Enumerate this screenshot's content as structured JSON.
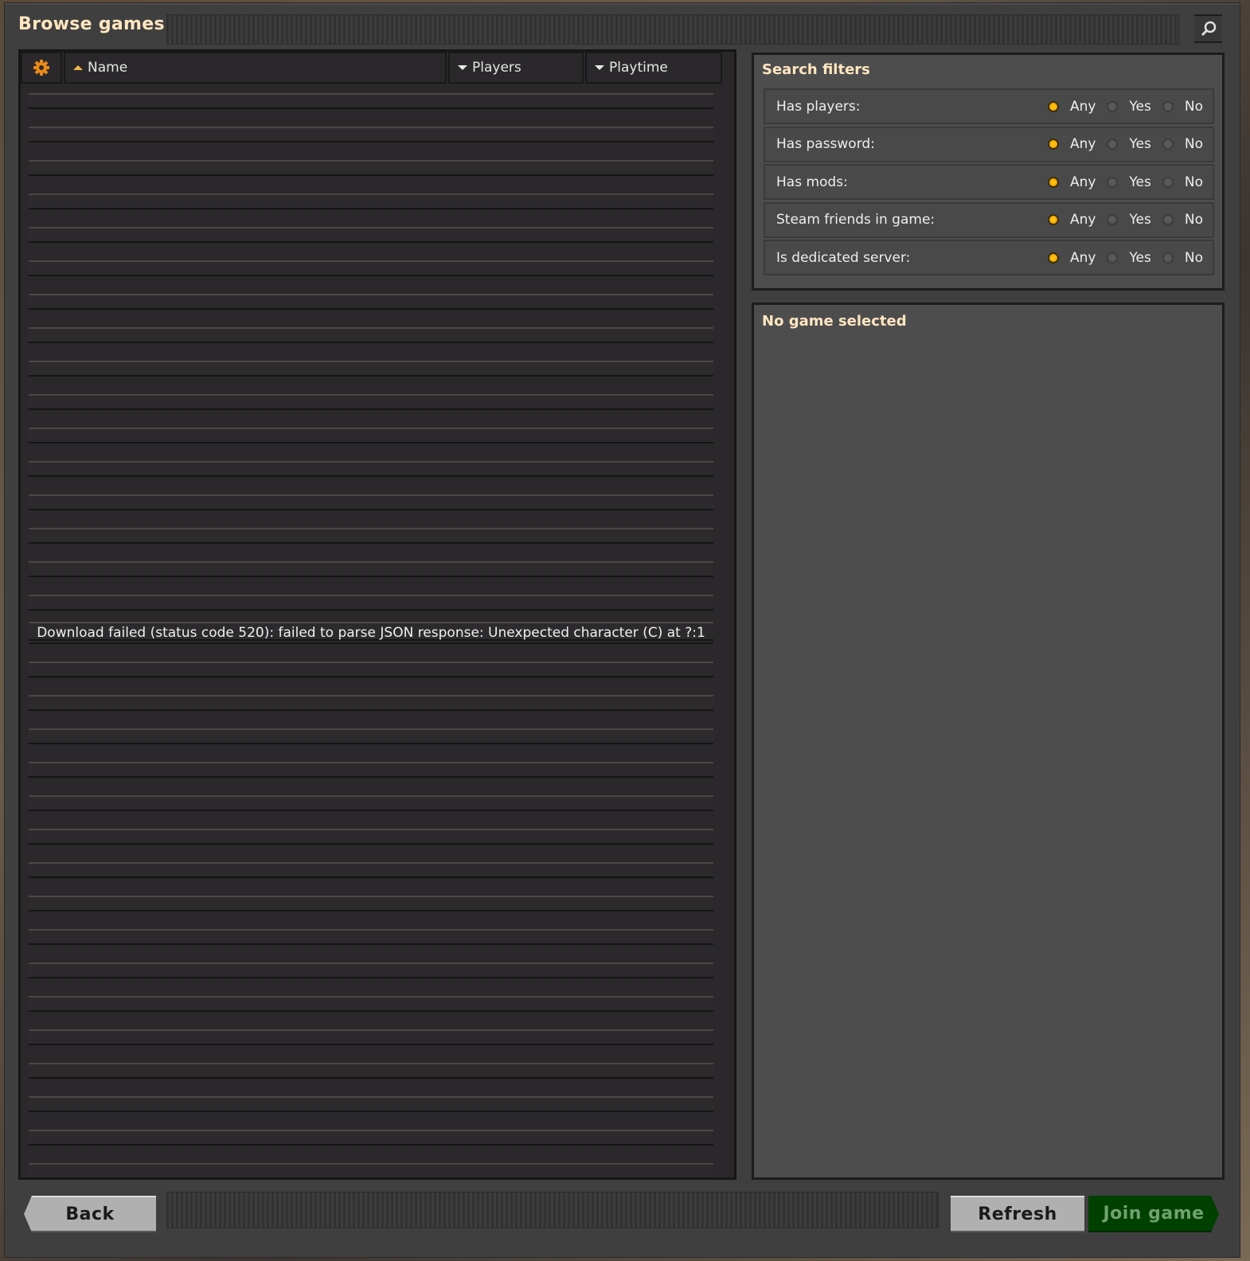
{
  "window": {
    "title": "Browse games"
  },
  "toolbar": {
    "search_icon": "magnifier-icon"
  },
  "list": {
    "settings_icon": "gear-icon",
    "columns": [
      {
        "label": "Name",
        "sort": "ascending"
      },
      {
        "label": "Players",
        "sort": "descending"
      },
      {
        "label": "Playtime",
        "sort": "descending"
      }
    ],
    "error_message": "Download failed (status code 520): failed to parse JSON response: Unexpected character (C) at ?:1"
  },
  "filters": {
    "title": "Search filters",
    "options": [
      "Any",
      "Yes",
      "No"
    ],
    "items": [
      {
        "label": "Has players:",
        "selected": "Any"
      },
      {
        "label": "Has password:",
        "selected": "Any"
      },
      {
        "label": "Has mods:",
        "selected": "Any"
      },
      {
        "label": "Steam friends in game:",
        "selected": "Any"
      },
      {
        "label": "Is dedicated server:",
        "selected": "Any"
      }
    ]
  },
  "details": {
    "title": "No game selected"
  },
  "buttons": {
    "back": "Back",
    "refresh": "Refresh",
    "join": "Join game"
  },
  "colors": {
    "accent": "#ffe6c0",
    "radio_selected": "#f5a700",
    "join_button": "#004000"
  }
}
